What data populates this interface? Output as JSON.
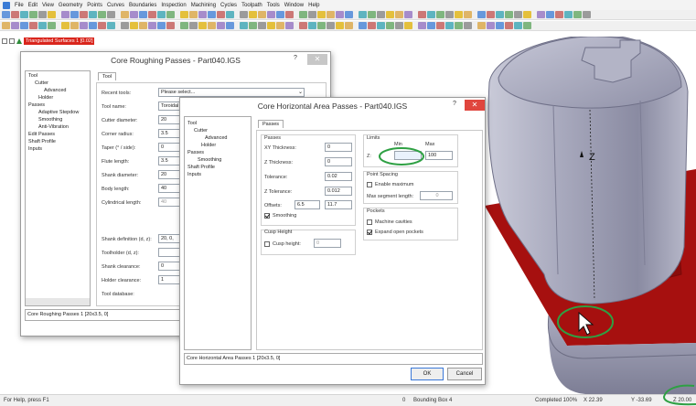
{
  "menubar": {
    "items": [
      "File",
      "Edit",
      "View",
      "Geometry",
      "Points",
      "Curves",
      "Boundaries",
      "Inspection",
      "Machining",
      "Cycles",
      "Toolpath",
      "Tools",
      "Window",
      "Help"
    ]
  },
  "object_tree": {
    "label": "Triangulated Surfaces 1 [0.02]"
  },
  "roughing_dialog": {
    "title": "Core Roughing Passes - Part040.IGS",
    "help": "?",
    "close": "✕",
    "tree": [
      "Tool",
      "Cutter",
      "Advanced",
      "Holder",
      "Passes",
      "Adaptive Stepdow",
      "Smoothing",
      "Anti-Vibration",
      "Edit Passes",
      "Shaft Profile",
      "Inputs"
    ],
    "tab": "Tool",
    "fields": [
      {
        "label": "Recent tools:",
        "value": "Please select..."
      },
      {
        "label": "Tool name:",
        "value": "Toroidal"
      },
      {
        "label": "Cutter diameter:",
        "value": "20"
      },
      {
        "label": "Corner radius:",
        "value": "3.5"
      },
      {
        "label": "Taper (° / side):",
        "value": "0"
      },
      {
        "label": "Flute length:",
        "value": "3.5"
      },
      {
        "label": "Shank diameter:",
        "value": "20"
      },
      {
        "label": "Body length:",
        "value": "40"
      },
      {
        "label": "Cylindrical length:",
        "value": "40"
      }
    ],
    "lower_fields": [
      {
        "label": "Shank definition (d, z):",
        "value": "20, 0,"
      },
      {
        "label": "Toolholder (d, z):",
        "value": ""
      },
      {
        "label": "Shank clearance:",
        "value": "0"
      },
      {
        "label": "Holder clearance:",
        "value": "1"
      },
      {
        "label": "Tool database:",
        "value": ""
      }
    ],
    "status": "Core Roughing Passes 1 [20x3.5, 0]"
  },
  "horizontal_dialog": {
    "title": "Core Horizontal Area Passes - Part040.IGS",
    "help": "?",
    "close": "✕",
    "tree": [
      "Tool",
      "Cutter",
      "Advanced",
      "Holder",
      "Passes",
      "Smoothing",
      "Shaft Profile",
      "Inputs"
    ],
    "tab": "Passes",
    "passes": {
      "title": "Passes",
      "xy_thickness_label": "XY Thickness:",
      "xy_thickness": "0",
      "z_thickness_label": "Z Thickness:",
      "z_thickness": "0",
      "tolerance_label": "Tolerance:",
      "tolerance": "0.02",
      "z_tolerance_label": "Z Tolerance:",
      "z_tolerance": "0.012",
      "offsets_label": "Offsets:",
      "offset_1": "6.5",
      "offset_2": "11.7",
      "smoothing_label": "Smoothing",
      "smoothing_checked": true
    },
    "cusp": {
      "title": "Cusp Height",
      "label": "Cusp height:",
      "checked": false,
      "value": "0"
    },
    "limits": {
      "title": "Limits",
      "min_label": "Min",
      "max_label": "Max",
      "z_label": "Z:",
      "min_value": "",
      "max_value": "100"
    },
    "point_spacing": {
      "title": "Point Spacing",
      "enable_label": "Enable maximum",
      "enable_checked": false,
      "max_seg_label": "Max segment length:",
      "max_seg_value": "0"
    },
    "pockets": {
      "title": "Pockets",
      "machine_cavities": "Machine cavities",
      "machine_cavities_checked": false,
      "expand_open": "Expand open pockets",
      "expand_open_checked": true
    },
    "status": "Core Horizontal Area Passes 1 [20x3.5, 0]",
    "ok_label": "OK",
    "cancel_label": "Cancel"
  },
  "viewport": {
    "z_axis_label": "Z",
    "part_color": "#9c9cb0",
    "base_color": "#a6100f",
    "highlight_color": "#2ea043"
  },
  "statusbar": {
    "help": "For Help, press F1",
    "count": "0",
    "bbox": "Bounding Box 4",
    "completed": "Completed  100%",
    "x": "X 22.39",
    "y": "Y -33.69",
    "z": "Z 20.00"
  }
}
